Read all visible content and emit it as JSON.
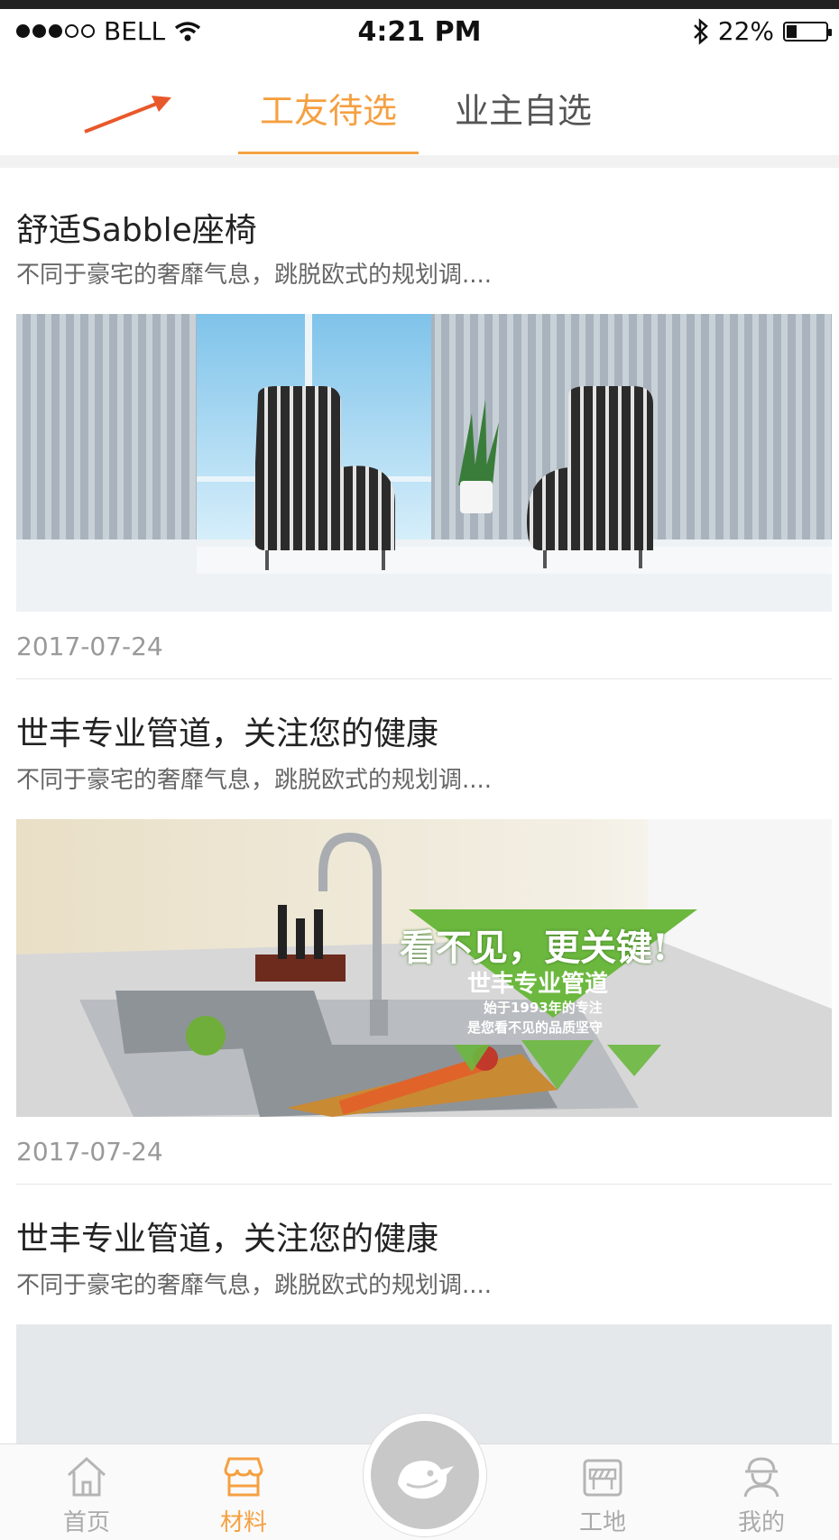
{
  "status_bar": {
    "carrier": "BELL",
    "time": "4:21 PM",
    "battery": "22%",
    "signal_bars_filled": 3,
    "signal_bars_total": 5
  },
  "tabs": [
    {
      "label": "工友待选",
      "active": true
    },
    {
      "label": "业主自选",
      "active": false
    }
  ],
  "feed": [
    {
      "title": "舒适Sabble座椅",
      "desc": "不同于豪宅的奢靡气息，跳脱欧式的规划调....",
      "date": "2017-07-24"
    },
    {
      "title": "世丰专业管道，关注您的健康",
      "desc": "不同于豪宅的奢靡气息，跳脱欧式的规划调....",
      "date": "2017-07-24",
      "banner": {
        "headline": "看不见，更关键!",
        "brand": "世丰专业管道",
        "line1": "始于1993年的专注",
        "line2": "是您看不见的品质坚守"
      }
    },
    {
      "title": "世丰专业管道，关注您的健康",
      "desc": "不同于豪宅的奢靡气息，跳脱欧式的规划调...."
    }
  ],
  "bottom_nav": [
    {
      "label": "首页",
      "icon": "home-icon",
      "active": false
    },
    {
      "label": "材料",
      "icon": "store-icon",
      "active": true
    },
    {
      "label": "工地",
      "icon": "construction-icon",
      "active": false
    },
    {
      "label": "我的",
      "icon": "worker-icon",
      "active": false
    }
  ],
  "colors": {
    "accent": "#f5a041",
    "annotation_arrow": "#e8582a",
    "banner_green": "#6cb83f"
  }
}
